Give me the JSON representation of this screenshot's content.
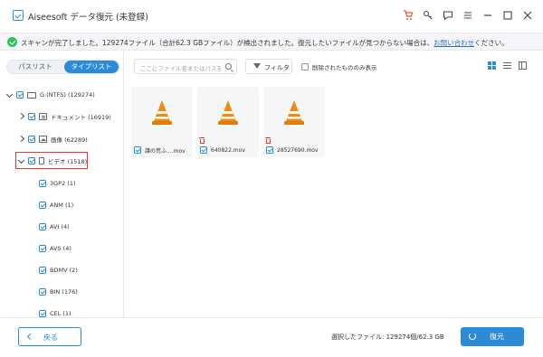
{
  "window": {
    "title": "Aiseesoft データ復元 (未登録)"
  },
  "notice": {
    "text": "スキャンが完了しました。129274ファイル（合計62.3 GBファイル）が検出されました。復元したいファイルが見つからない場合は、",
    "link": "お問い合わせ",
    "tail": "ください。"
  },
  "sidebar": {
    "tabs": [
      "パスリスト",
      "タイプリスト"
    ],
    "drive": "G:(NTFS) (129274)",
    "categories": [
      {
        "label": "ドキュメント (16919)",
        "icon": "document-icon"
      },
      {
        "label": "画像 (62289)",
        "icon": "image-icon"
      },
      {
        "label": "ビデオ (1518)",
        "icon": "video-icon"
      }
    ],
    "video_types": [
      "3GP2 (1)",
      "ANM (1)",
      "AVI (4)",
      "AVS (4)",
      "BDMV (2)",
      "BIN (176)",
      "CEL (1)"
    ]
  },
  "toolbar": {
    "search_placeholder": "ここにファイル名またはパスを",
    "filter_label": "フィルタ",
    "deleted_only_label": "削除されたもののみ表示"
  },
  "files": [
    {
      "name": "譲の荒ふ....mov",
      "deleted": false
    },
    {
      "name": "640822.mov",
      "deleted": true
    },
    {
      "name": "28527690.mov",
      "deleted": true
    }
  ],
  "footer": {
    "back_label": "戻る",
    "selected_info": "選択したファイル: 129274個/62.3 GB",
    "recover_label": "復元"
  },
  "colors": {
    "accent": "#2b8bd7",
    "highlight": "#e53935",
    "success": "#33c15b"
  }
}
